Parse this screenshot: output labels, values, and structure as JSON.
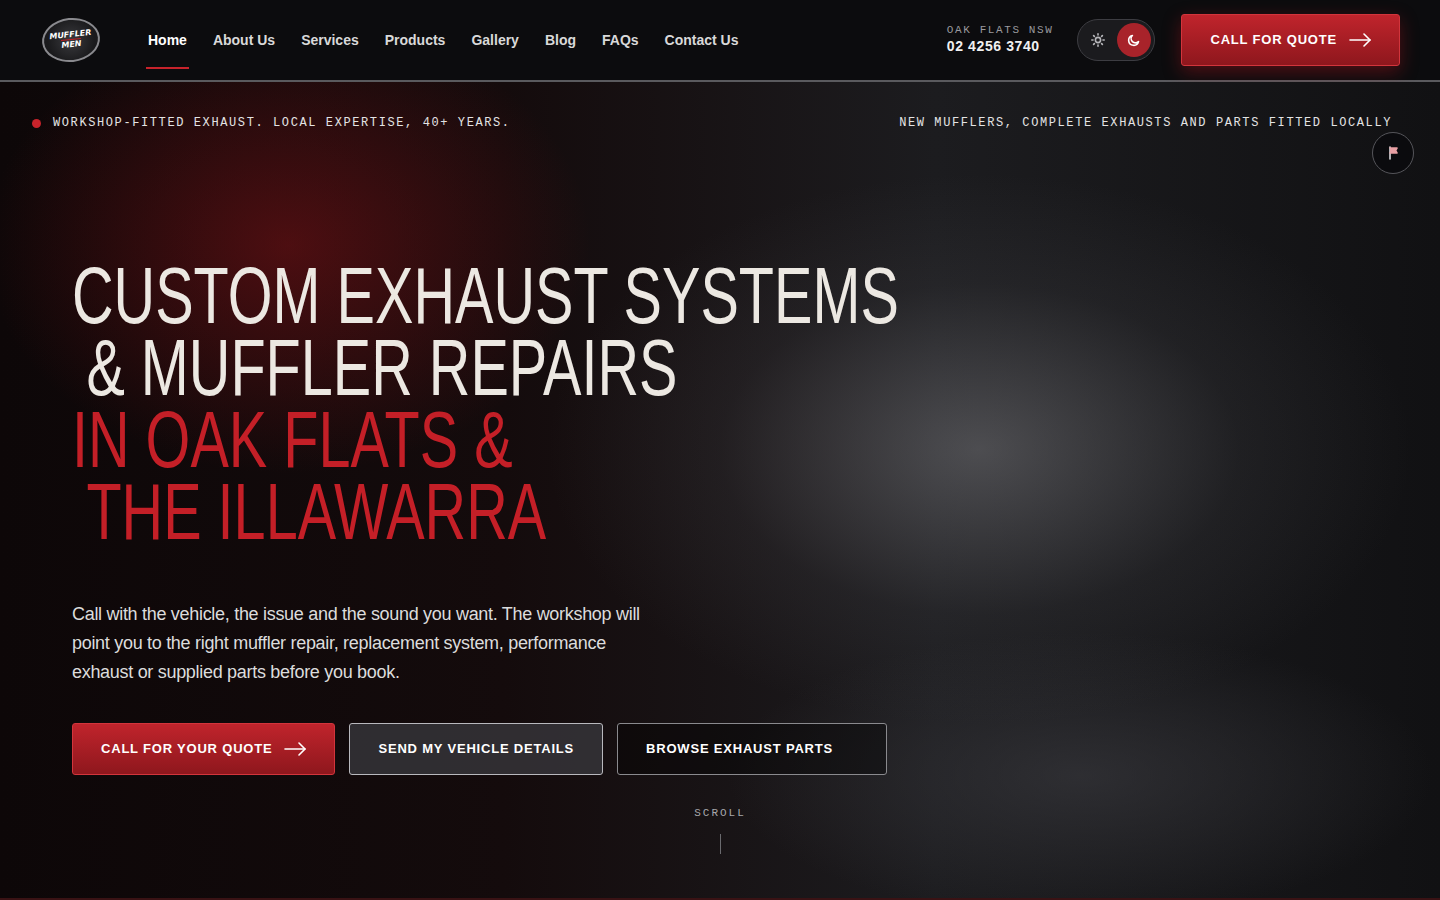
{
  "brand": {
    "line1": "MUFFLER",
    "line2": "MEN"
  },
  "nav": [
    {
      "label": "Home",
      "selected": true
    },
    {
      "label": "About Us",
      "selected": false
    },
    {
      "label": "Services",
      "selected": false
    },
    {
      "label": "Products",
      "selected": false
    },
    {
      "label": "Gallery",
      "selected": false
    },
    {
      "label": "Blog",
      "selected": false
    },
    {
      "label": "FAQs",
      "selected": false
    },
    {
      "label": "Contact Us",
      "selected": false
    }
  ],
  "header_contact": {
    "location": "OAK FLATS NSW",
    "phone": "02 4256 3740"
  },
  "theme_toggle": [
    {
      "selected": false
    },
    {
      "selected": true
    }
  ],
  "header_cta": "CALL FOR QUOTE",
  "hero": {
    "tagline_left": "WORKSHOP-FITTED EXHAUST. LOCAL EXPERTISE, 40+ YEARS.",
    "tagline_right": "NEW MUFFLERS, COMPLETE EXHAUSTS AND PARTS FITTED LOCALLY",
    "heading_lines": [
      {
        "text": "CUSTOM EXHAUST SYSTEMS",
        "accent": false
      },
      {
        "text": "& MUFFLER REPAIRS",
        "accent": false
      },
      {
        "text": "IN OAK FLATS &",
        "accent": true
      },
      {
        "text": "THE ILLAWARRA",
        "accent": true
      }
    ],
    "intro": "Call with the vehicle, the issue and the sound you want. The workshop will point you to the right muffler repair, replacement system, performance exhaust or supplied parts before you book.",
    "buttons": [
      {
        "label": "CALL FOR YOUR QUOTE",
        "kind": "primary"
      },
      {
        "label": "SEND MY VEHICLE DETAILS",
        "kind": "glass"
      },
      {
        "label": "BROWSE EXHAUST PARTS",
        "kind": "outline"
      }
    ],
    "scroll_label": "SCROLL"
  }
}
